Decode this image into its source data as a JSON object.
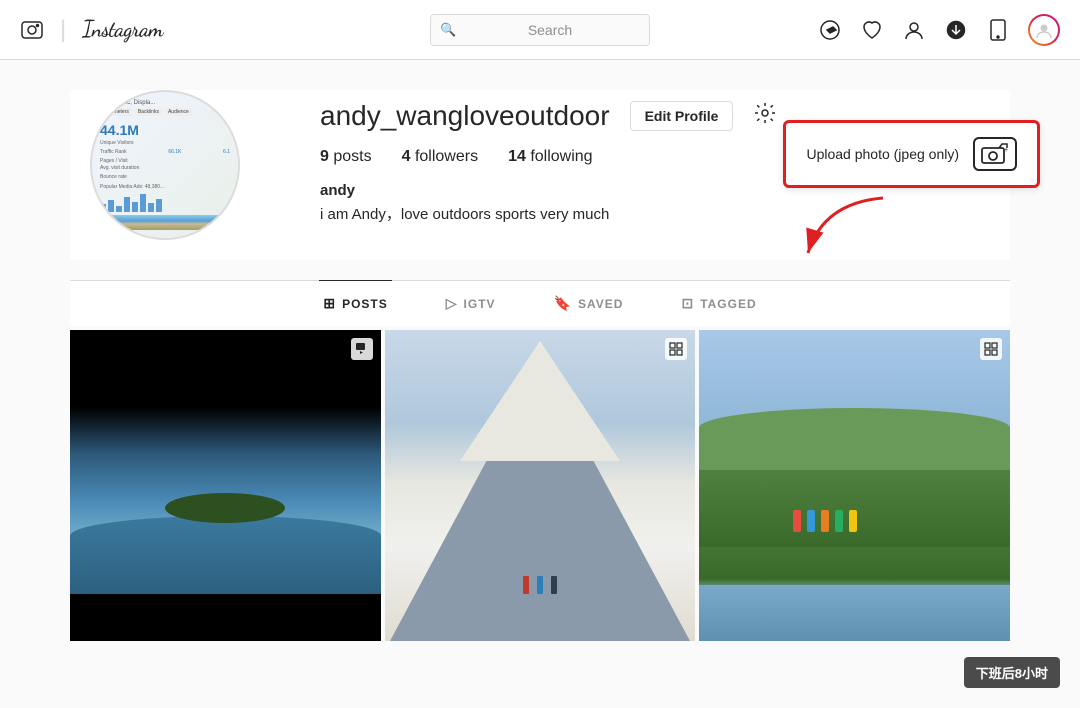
{
  "header": {
    "logo": "Instagram",
    "divider": "|",
    "search_placeholder": "Search",
    "icons": {
      "compass": "✈",
      "heart": "♡",
      "person": "👤",
      "download": "⬇",
      "phone": "📱",
      "avatar": ""
    }
  },
  "profile": {
    "username": "andy_wangloveoutdoor",
    "edit_button": "Edit Profile",
    "stats": {
      "posts_count": "9",
      "posts_label": "posts",
      "followers_count": "4",
      "followers_label": "followers",
      "following_count": "14",
      "following_label": "following"
    },
    "name": "andy",
    "bio": "i am Andy，love outdoors sports very much"
  },
  "upload_tooltip": {
    "text": "Upload photo (jpeg only)"
  },
  "tabs": [
    {
      "id": "posts",
      "label": "POSTS",
      "icon": "⊞",
      "active": true
    },
    {
      "id": "igtv",
      "label": "IGTV",
      "icon": "▷",
      "active": false
    },
    {
      "id": "saved",
      "label": "SAVED",
      "icon": "🔖",
      "active": false
    },
    {
      "id": "tagged",
      "label": "TAGGED",
      "icon": "⊡",
      "active": false
    }
  ],
  "grid": {
    "items": [
      {
        "id": 1,
        "type": "video",
        "icon": "▣"
      },
      {
        "id": 2,
        "type": "multi",
        "icon": "⧉"
      },
      {
        "id": 3,
        "type": "multi",
        "icon": "⧉"
      }
    ]
  },
  "watermark": "下班后8小时"
}
